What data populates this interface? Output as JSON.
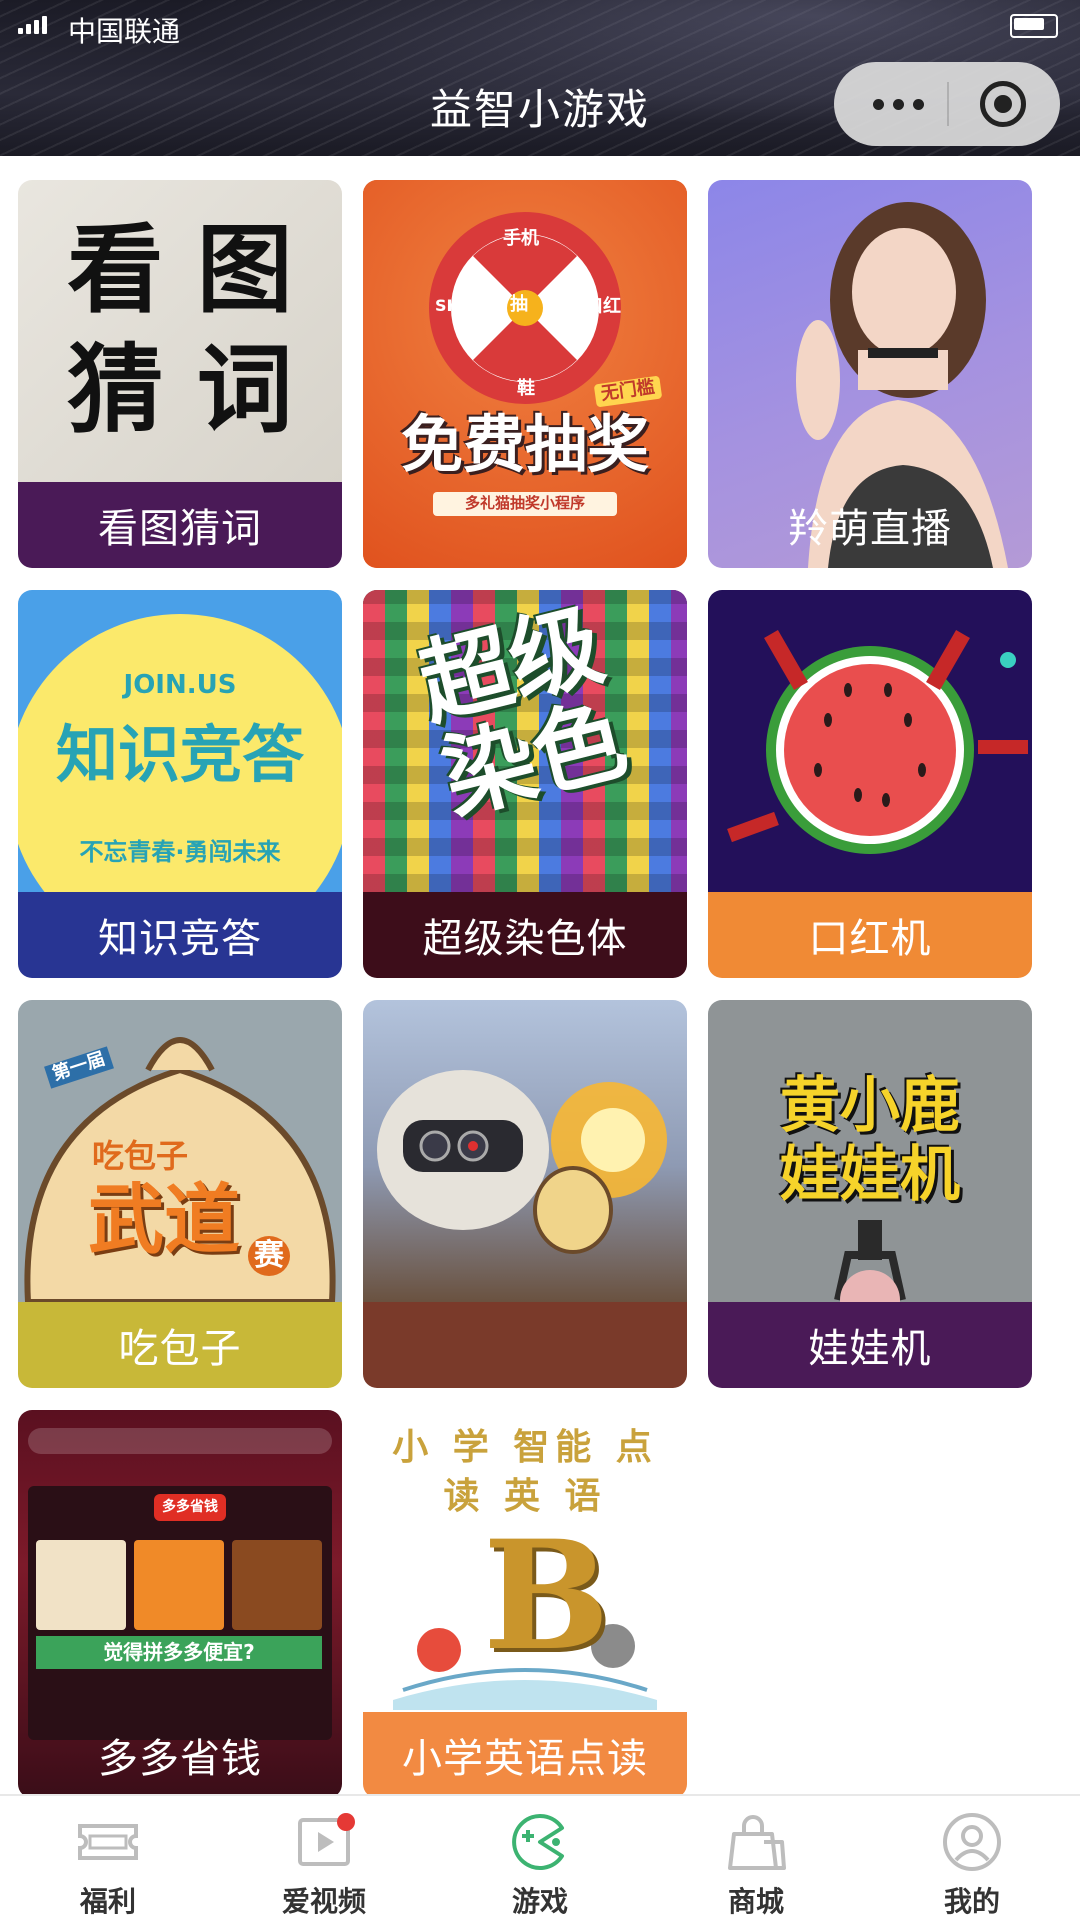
{
  "status_bar": {
    "carrier": "中国联通"
  },
  "header": {
    "title": "益智小游戏"
  },
  "games": [
    {
      "name": "看图猜词",
      "art_text": "看 图\n猜 词",
      "bar_color": "#4a1a57"
    },
    {
      "name": "",
      "art_text": "免费抽奖",
      "art_sub": "多礼猫抽奖小程序",
      "art_badge": "无门槛",
      "wheel": [
        "手机",
        "口红",
        "鞋",
        "SK-II",
        "抽"
      ],
      "bar_color": "#e8622a"
    },
    {
      "name": "羚萌直播",
      "bar_color": "#9b8fd8"
    },
    {
      "name": "知识竞答",
      "art_text": "知识竞答",
      "art_top": "JOIN.US",
      "art_sub": "不忘青春·勇闯未来",
      "bar_color": "#283593"
    },
    {
      "name": "超级染色体",
      "art_text": "超级\n染色",
      "bar_color": "#3d0d1a"
    },
    {
      "name": "口红机",
      "bar_color": "#f08a35"
    },
    {
      "name": "吃包子",
      "art_text": "武道",
      "art_top": "吃包子",
      "art_badge": "第一届",
      "art_sub": "赛",
      "bar_color": "#c8b838"
    },
    {
      "name": "",
      "bar_color": "#7a3a2a"
    },
    {
      "name": "娃娃机",
      "art_text": "黄小鹿\n娃娃机",
      "bar_color": "#4a1a57"
    },
    {
      "name": "多多省钱",
      "art_top": "多多省钱",
      "art_sub": "觉得拼多多便宜?",
      "bar_color": "transparent"
    },
    {
      "name": "小学英语点读",
      "art_text": "B",
      "art_top": "小 学 智能 点读 英 语",
      "bar_color": "#f28a42"
    }
  ],
  "tabs": [
    {
      "label": "福利",
      "icon": "ticket-icon"
    },
    {
      "label": "爱视频",
      "icon": "video-icon"
    },
    {
      "label": "游戏",
      "icon": "game-icon",
      "active": true
    },
    {
      "label": "商城",
      "icon": "shopping-bag-icon"
    },
    {
      "label": "我的",
      "icon": "user-icon"
    }
  ],
  "colors": {
    "accent": "#3cb371",
    "badge": "#e53935"
  }
}
